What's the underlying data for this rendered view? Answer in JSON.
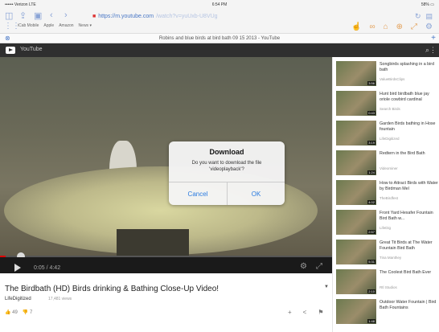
{
  "status": {
    "carrier": "•••••• Verizon  LTE",
    "time": "6:54 PM",
    "battery": "58% ▭"
  },
  "browser": {
    "url_main": "https://m.youtube.com",
    "url_rest": "/watch?v=yuUxb-U8VUg",
    "bookmarks": [
      "iCab Mobile",
      "Apple",
      "Amazon",
      "News ▾"
    ],
    "tab_title": "Robins and blue birds at bird bath 09 15 2013 - YouTube"
  },
  "youtube": {
    "name": "YouTube"
  },
  "player": {
    "elapsed": "0:05",
    "duration": "4:42",
    "progress": 0.018
  },
  "dialog": {
    "title": "Download",
    "message": "Do you want to download the file 'videoplayback'?",
    "cancel": "Cancel",
    "ok": "OK"
  },
  "video": {
    "title": "The Birdbath (HD) Birds drinking & Bathing Close-Up Video!",
    "channel": "LifeDigitized",
    "views": "17,481 views",
    "likes": "49",
    "dislikes": "7"
  },
  "related": [
    {
      "title": "Songbirds splashing in a bird bath",
      "channel": "ValueBirdsClips",
      "duration": "3:56"
    },
    {
      "title": "Hunt bird birdbath blue jay oriole cowbird cardinal",
      "channel": "Search Birds",
      "duration": "0:43"
    },
    {
      "title": "Garden Birds bathing in Hose fountain",
      "channel": "LifeDigitized",
      "duration": "3:19"
    },
    {
      "title": "Redtern in the Bird Bath",
      "channel": "Videominer",
      "duration": "1:24"
    },
    {
      "title": "How to Attract Birds with Water by Birdman Mel",
      "channel": "TheBirdfest",
      "duration": "4:02"
    },
    {
      "title": "Front Yard Hexafer Fountain Bird Bath w...",
      "channel": "LifeDig",
      "duration": "2:57"
    },
    {
      "title": "Great Tit Birds at The Water Fountain Bird Bath",
      "channel": "Tina Manthey",
      "duration": "5:31"
    },
    {
      "title": "The Coolest Bird Bath Ever",
      "channel": "Rtl Studios",
      "duration": "2:10"
    },
    {
      "title": "Outdoor Water Fountain | Bird Bath Fountains",
      "channel": "",
      "duration": "1:48"
    }
  ]
}
